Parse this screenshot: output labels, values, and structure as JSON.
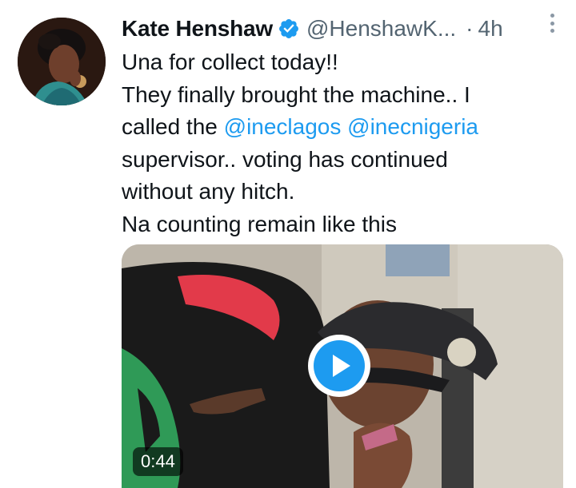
{
  "author": {
    "name": "Kate Henshaw",
    "handle": "@HenshawK...",
    "separator": "·",
    "time": "4h",
    "verified_color": "#1d9bf0"
  },
  "tweet": {
    "line1": "Una for collect today!!",
    "line2": "They finally brought the machine.. I",
    "line3_prefix": "called the ",
    "mention1": "@ineclagos",
    "mention2": "@inecnigeria",
    "line4": "supervisor.. voting has continued",
    "line5": "without any hitch.",
    "line6": "Na counting remain like this"
  },
  "media": {
    "duration": "0:44",
    "play_color": "#1d9bf0"
  },
  "icons": {
    "verified": "verified-badge-icon",
    "more": "more-options-icon",
    "play": "play-icon"
  },
  "colors": {
    "text": "#0f1419",
    "secondary": "#536471",
    "link": "#1d9bf0"
  }
}
